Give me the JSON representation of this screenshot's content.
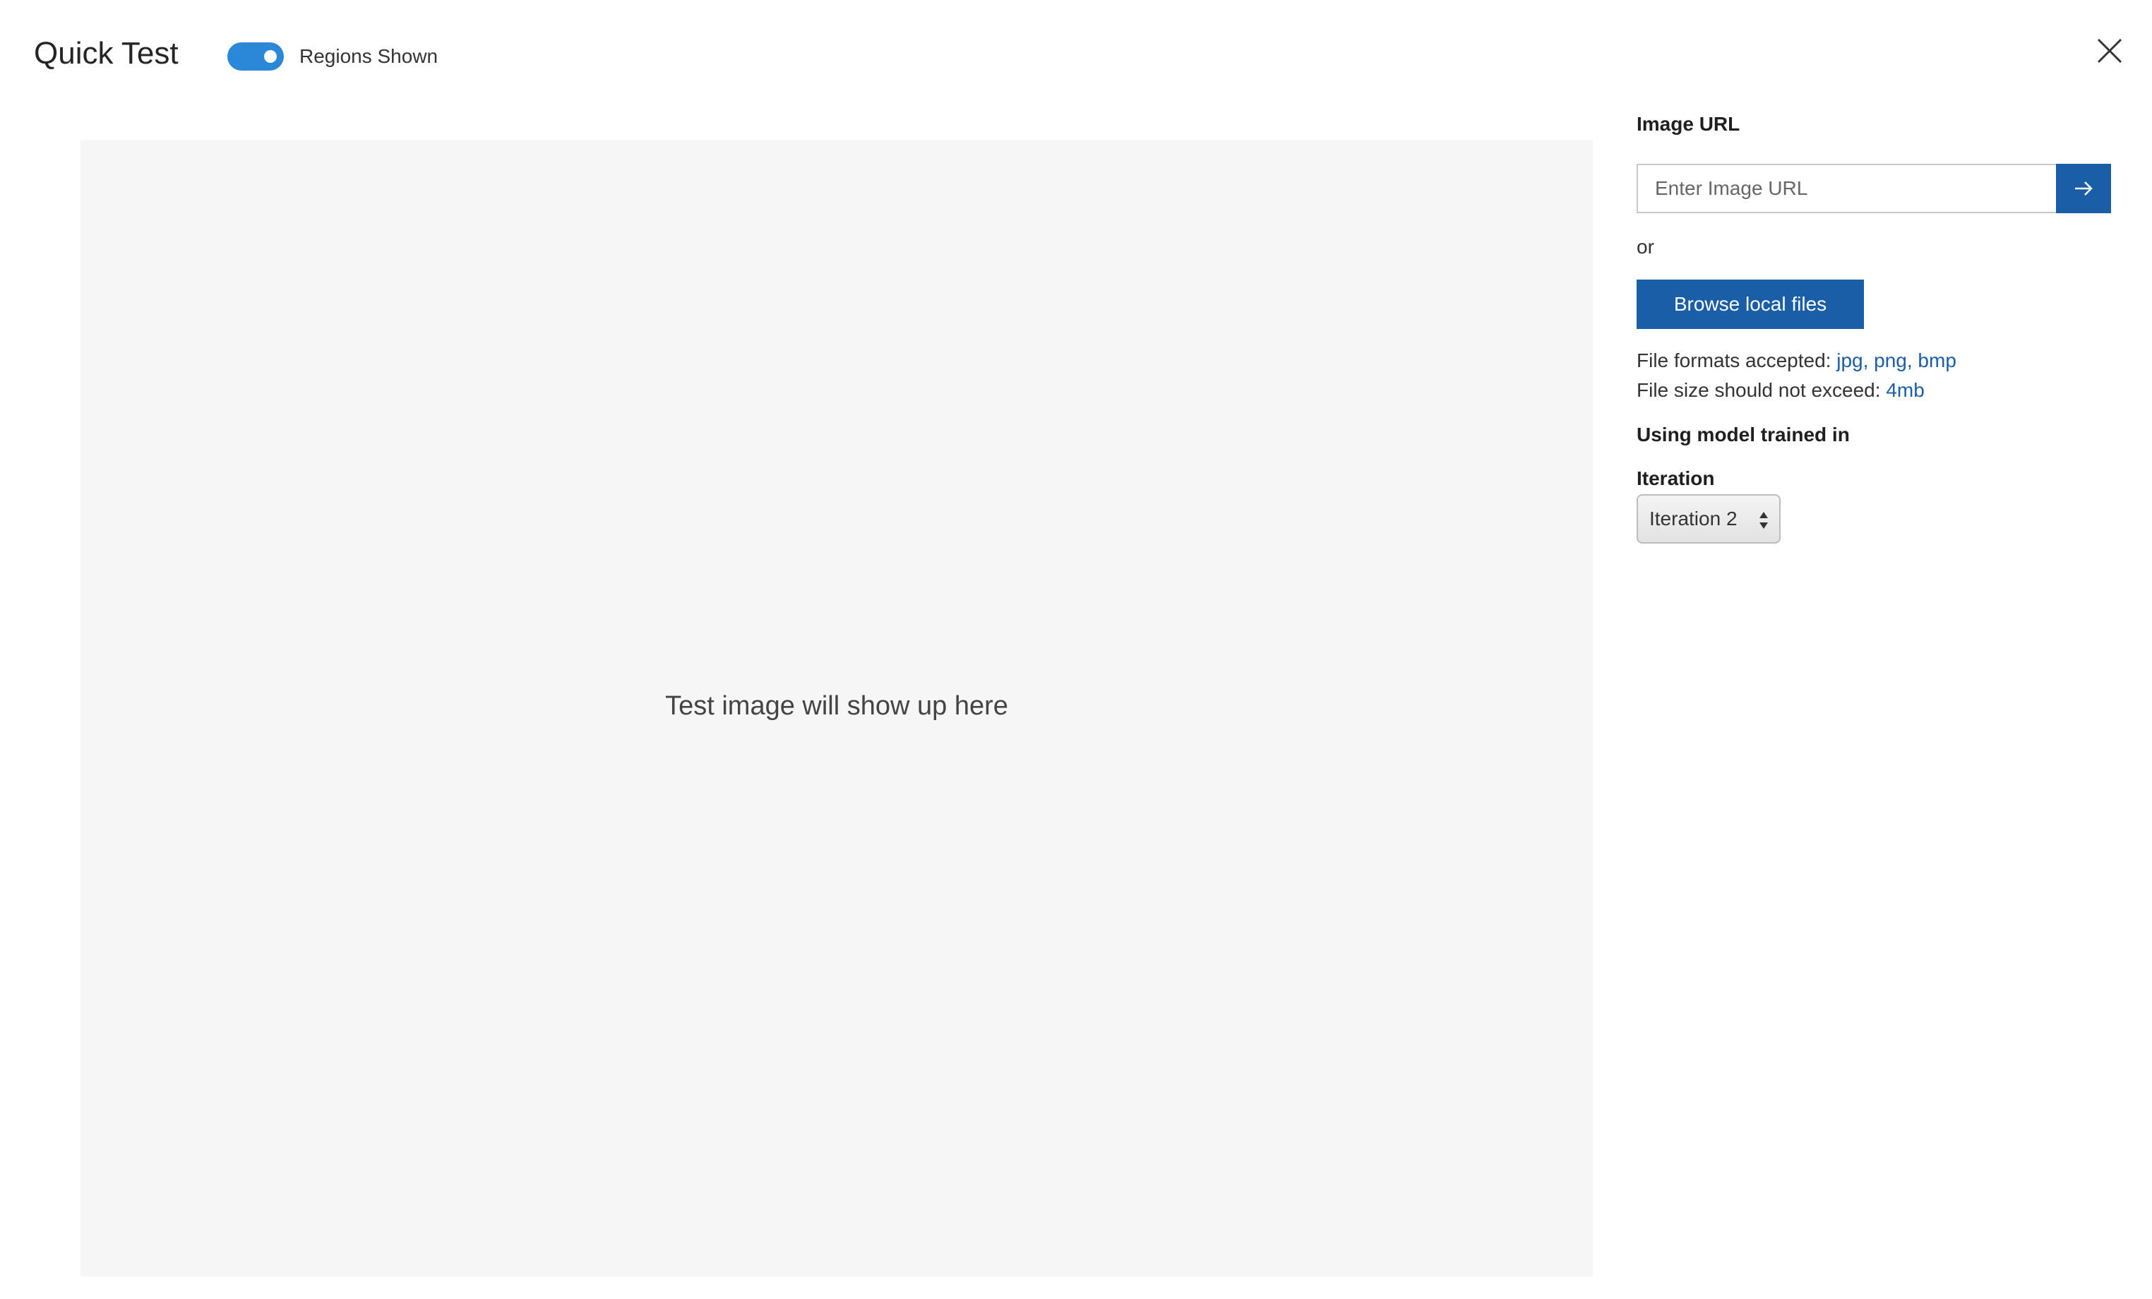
{
  "header": {
    "title": "Quick Test",
    "toggle_label": "Regions Shown",
    "toggle_on": true,
    "close_icon": "close-icon"
  },
  "image_area": {
    "placeholder": "Test image will show up here"
  },
  "panel": {
    "url_label": "Image URL",
    "url_placeholder": "Enter Image URL",
    "url_value": "",
    "go_icon": "arrow-right-icon",
    "or_text": "or",
    "browse_label": "Browse local files",
    "formats_prefix": "File formats accepted: ",
    "formats_value": "jpg, png, bmp",
    "size_prefix": "File size should not exceed: ",
    "size_value": "4mb",
    "model_label": "Using model trained in",
    "iteration_label": "Iteration",
    "iteration_selected": "Iteration 2"
  },
  "colors": {
    "accent": "#1a5ea8",
    "toggle": "#2b88d8",
    "image_bg": "#f6f6f6"
  }
}
